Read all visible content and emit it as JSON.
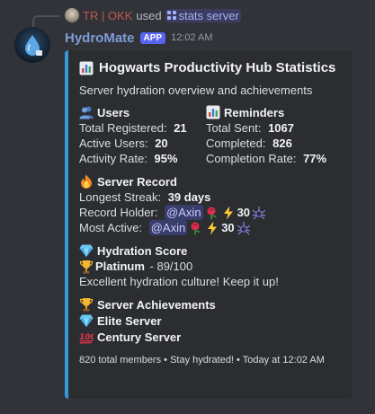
{
  "reply": {
    "username": "TR | OKK",
    "used_text": "used",
    "command": "stats server"
  },
  "header": {
    "bot_name": "HydroMate",
    "badge": "APP",
    "timestamp": "12:02 AM"
  },
  "embed": {
    "accent_color": "#3498db",
    "title": "Hogwarts Productivity Hub Statistics",
    "title_icon": "bar-chart-icon",
    "description": "Server hydration overview and achievements",
    "users": {
      "name": "Users",
      "icon": "users-icon",
      "lines": [
        {
          "label": "Total Registered: ",
          "value": "21"
        },
        {
          "label": "Active Users: ",
          "value": "20"
        },
        {
          "label": "Activity Rate: ",
          "value": "95%"
        }
      ]
    },
    "reminders": {
      "name": "Reminders",
      "icon": "bar-chart-icon",
      "lines": [
        {
          "label": "Total Sent: ",
          "value": "1067"
        },
        {
          "label": "Completed: ",
          "value": "826"
        },
        {
          "label": "Completion Rate: ",
          "value": "77%"
        }
      ]
    },
    "record": {
      "name": "Server Record",
      "icon": "fire-icon",
      "streak_label": "Longest Streak: ",
      "streak_value": "39 days",
      "holder_label": "Record Holder: ",
      "holder_mention": "@Axin",
      "holder_level": "30",
      "active_label": "Most Active: ",
      "active_mention": "@Axin",
      "active_level": "30"
    },
    "score": {
      "name": "Hydration Score",
      "icon": "gem-icon",
      "tier": "Platinum",
      "tier_suffix": " - 89/100",
      "message": "Excellent hydration culture! Keep it up!"
    },
    "achievements": {
      "name": "Server Achievements",
      "icon": "trophy-icon",
      "items": [
        {
          "icon": "gem-icon",
          "label": "Elite Server"
        },
        {
          "icon": "hundred-icon",
          "label": "Century Server"
        }
      ]
    },
    "footer": "820 total members • Stay hydrated! • Today at 12:02 AM"
  },
  "colors": {
    "background": "#323339",
    "embed_bg": "#2b2d31",
    "bot_name": "#7e9dd8",
    "reply_user": "#c0584f",
    "badge": "#5865f2"
  }
}
